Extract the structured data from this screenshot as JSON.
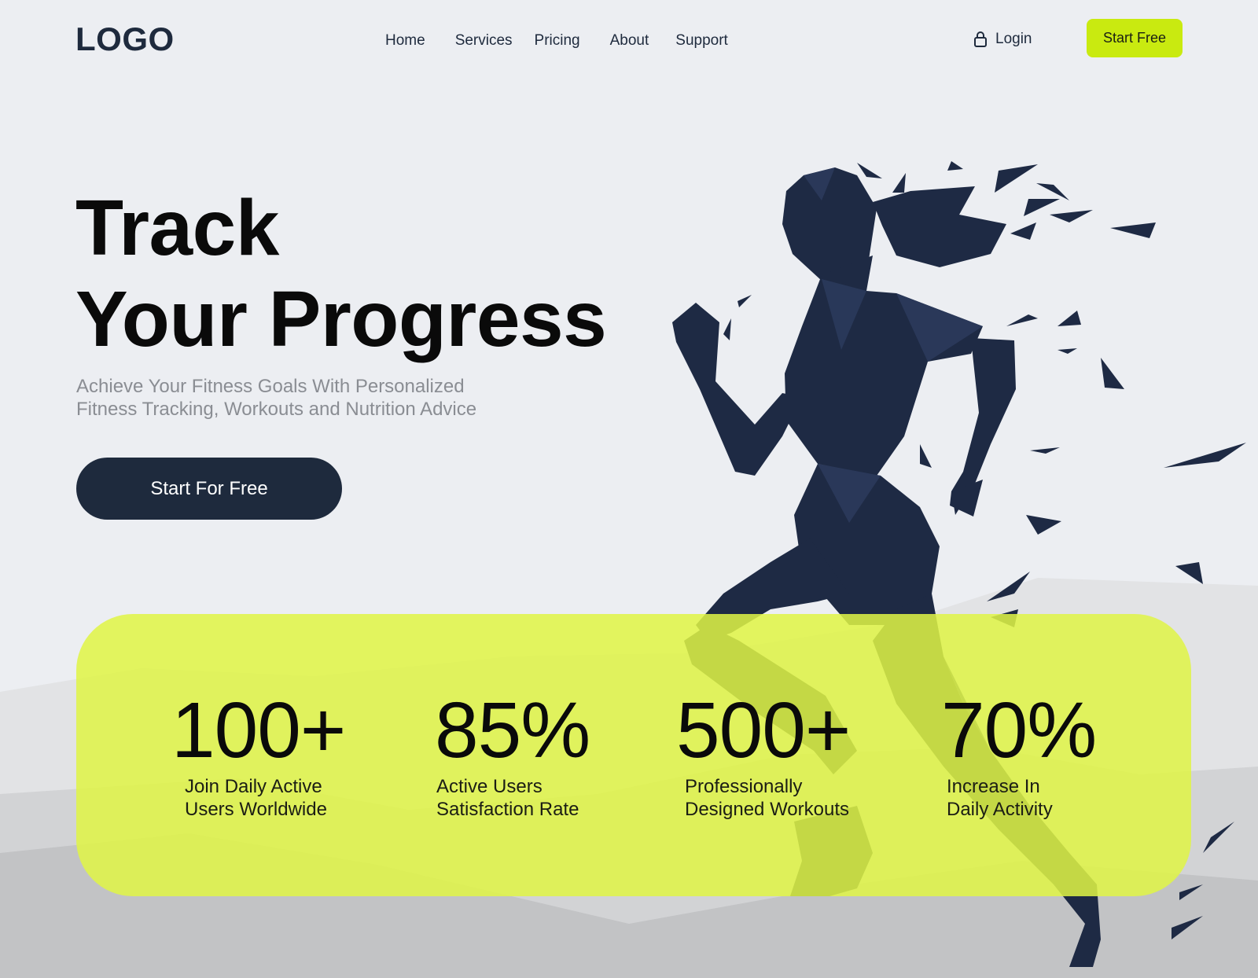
{
  "header": {
    "logo": "LOGO",
    "nav": [
      "Home",
      "Services",
      "Pricing",
      "About",
      "Support"
    ],
    "login_label": "Login",
    "start_free_label": "Start Free"
  },
  "hero": {
    "title_line1": "Track",
    "title_line2": "Your Progress",
    "subtitle_line1": "Achieve Your Fitness Goals With Personalized",
    "subtitle_line2": "Fitness Tracking, Workouts and Nutrition Advice",
    "cta_label": "Start For Free"
  },
  "stats": [
    {
      "value": "100+",
      "label_line1": "Join Daily Active",
      "label_line2": "Users Worldwide"
    },
    {
      "value": "85%",
      "label_line1": "Active Users",
      "label_line2": "Satisfaction Rate"
    },
    {
      "value": "500+",
      "label_line1": "Professionally",
      "label_line2": "Designed Workouts"
    },
    {
      "value": "70%",
      "label_line1": "Increase In",
      "label_line2": "Daily Activity"
    }
  ],
  "icons": {
    "login": "lock-icon",
    "hero_image": "low-poly-running-woman"
  },
  "colors": {
    "accent": "#c9ea10",
    "stats_panel": "#e0f546",
    "dark": "#1e2a3d",
    "background": "#eceef2"
  }
}
